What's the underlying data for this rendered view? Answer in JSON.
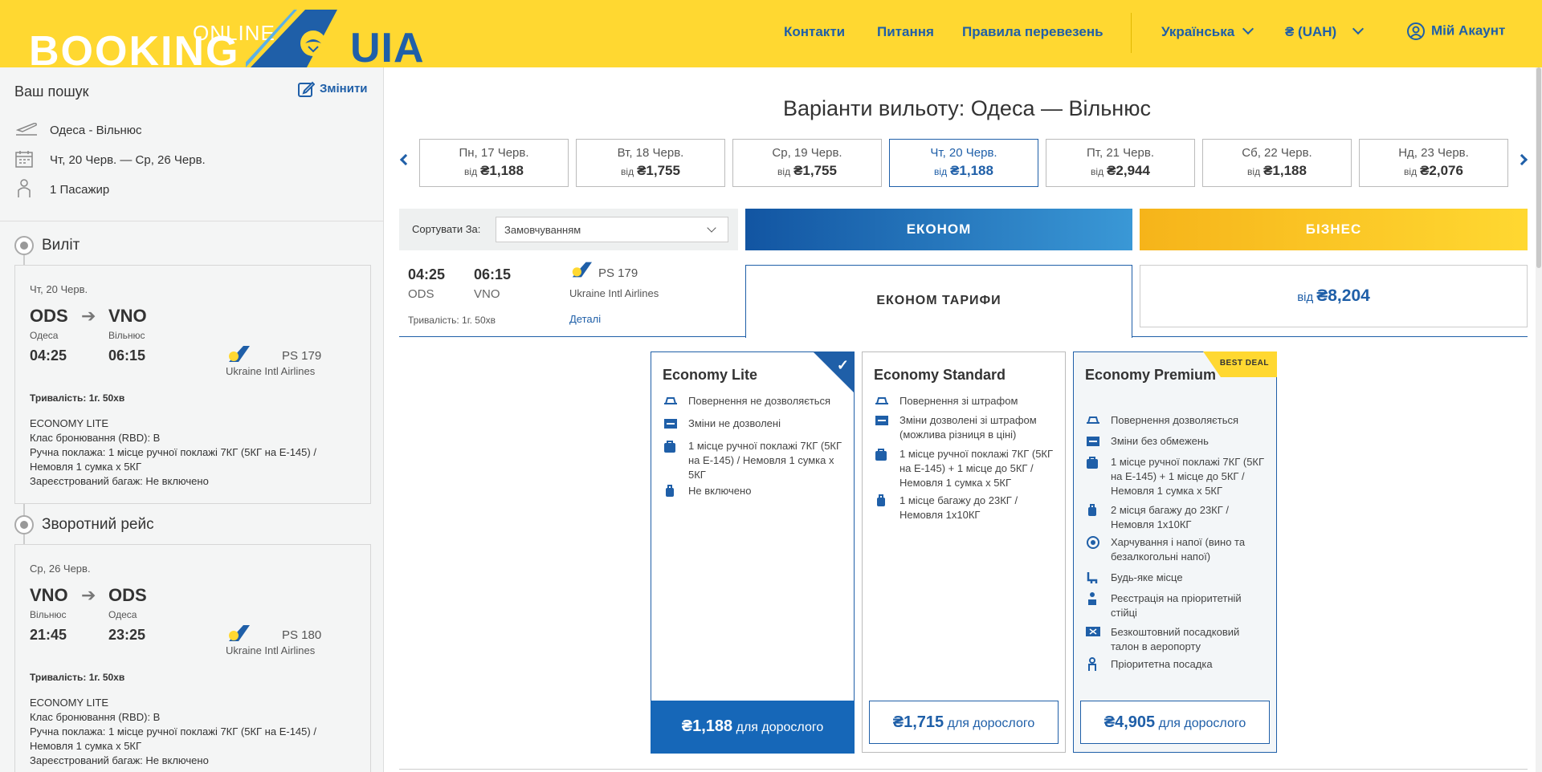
{
  "header": {
    "logo_online": "ONLINE",
    "logo_booking": "BOOKING",
    "logo_uia": "UIA",
    "nav": [
      "Контакти",
      "Питання",
      "Правила перевезень"
    ],
    "language": "Українська",
    "currency": "₴ (UAH)",
    "account": "Мій Акаунт"
  },
  "sidebar": {
    "search_title": "Ваш пошук",
    "edit_label": "Змінити",
    "route": "Одеса - Вільнюс",
    "dates": "Чт, 20 Черв. — Ср, 26 Черв.",
    "passengers": "1 Пасажир",
    "outbound": {
      "title": "Виліт",
      "date": "Чт, 20 Черв.",
      "from_code": "ODS",
      "to_code": "VNO",
      "from_city": "Одеса",
      "to_city": "Вільнюс",
      "dep_time": "04:25",
      "arr_time": "06:15",
      "flight_no": "PS 179",
      "airline": "Ukraine Intl Airlines",
      "duration": "Тривалість: 1г. 50хв",
      "fare": "ECONOMY LITE",
      "rbd": "Клас бронювання (RBD):  B",
      "hand_baggage": "Ручна поклажа: 1 місце ручної поклажі 7КГ (5КГ на E-145) / Немовля 1 сумка x 5КГ",
      "checked": "Зареєстрований багаж: Не включено"
    },
    "inbound": {
      "title": "Зворотний рейс",
      "date": "Ср, 26 Черв.",
      "from_code": "VNO",
      "to_code": "ODS",
      "from_city": "Вільнюс",
      "to_city": "Одеса",
      "dep_time": "21:45",
      "arr_time": "23:25",
      "flight_no": "PS 180",
      "airline": "Ukraine Intl Airlines",
      "duration": "Тривалість: 1г. 50хв",
      "fare": "ECONOMY LITE",
      "rbd": "Клас бронювання (RBD):  B",
      "hand_baggage": "Ручна поклажа: 1 місце ручної поклажі 7КГ (5КГ на E-145) / Немовля 1 сумка x 5КГ",
      "checked": "Зареєстрований багаж: Не включено"
    }
  },
  "main": {
    "title": "Варіанти вильоту: Одеса — Вільнюс",
    "price_prefix": "від",
    "dates": [
      {
        "label": "Пн, 17 Черв.",
        "price": "₴1,188"
      },
      {
        "label": "Вт, 18 Черв.",
        "price": "₴1,755"
      },
      {
        "label": "Ср, 19 Черв.",
        "price": "₴1,755"
      },
      {
        "label": "Чт, 20 Черв.",
        "price": "₴1,188"
      },
      {
        "label": "Пт, 21 Черв.",
        "price": "₴2,944"
      },
      {
        "label": "Сб, 22 Черв.",
        "price": "₴1,188"
      },
      {
        "label": "Нд, 23 Черв.",
        "price": "₴2,076"
      }
    ],
    "selected_date_index": 3,
    "sort_label": "Сортувати За:",
    "sort_value": "Замовчуванням",
    "tab_economy": "ЕКОНОМ",
    "tab_business": "БІЗНЕС",
    "flight": {
      "dep_time": "04:25",
      "arr_time": "06:15",
      "dep_code": "ODS",
      "arr_code": "VNO",
      "flight_no": "PS 179",
      "airline": "Ukraine Intl Airlines",
      "duration": "Тривалість: 1г. 50хв",
      "details": "Деталі"
    },
    "economy_fares_label": "ЕКОНОМ ТАРИФИ",
    "business_from": "від",
    "business_price": "₴8,204",
    "per_adult": "для дорослого",
    "best_deal": "BEST DEAL",
    "fares": [
      {
        "name": "Economy Lite",
        "price": "₴1,188",
        "features": [
          "Повернення не дозволяється",
          "Зміни не дозволені",
          "1 місце ручної поклажі 7КГ (5КГ на E-145) / Немовля 1 сумка x 5КГ",
          "Не включено"
        ]
      },
      {
        "name": "Economy Standard",
        "price": "₴1,715",
        "features": [
          "Повернення зі штрафом",
          "Зміни дозволені зі штрафом (можлива різниця в ціні)",
          "1 місце ручної поклажі 7КГ (5КГ на E-145) + 1 місце до 5КГ / Немовля 1 сумка x 5КГ",
          "1 місце багажу до 23КГ / Немовля 1x10КГ"
        ]
      },
      {
        "name": "Economy Premium",
        "price": "₴4,905",
        "features": [
          "Повернення дозволяється",
          "Зміни без обмежень",
          "1 місце ручної поклажі 7КГ (5КГ на E-145) + 1 місце до 5КГ / Немовля 1 сумка x 5КГ",
          "2 місця багажу до 23КГ / Немовля 1x10КГ",
          "Харчування і напої (вино та безалкогольні напої)",
          "Будь-яке місце",
          "Реєстрація на пріоритетній стійці",
          "Безкоштовний посадковий талон в аеропорту",
          "Пріоритетна посадка"
        ]
      }
    ]
  },
  "colors": {
    "brand_yellow": "#ffd831",
    "brand_blue": "#1f5fa8"
  }
}
